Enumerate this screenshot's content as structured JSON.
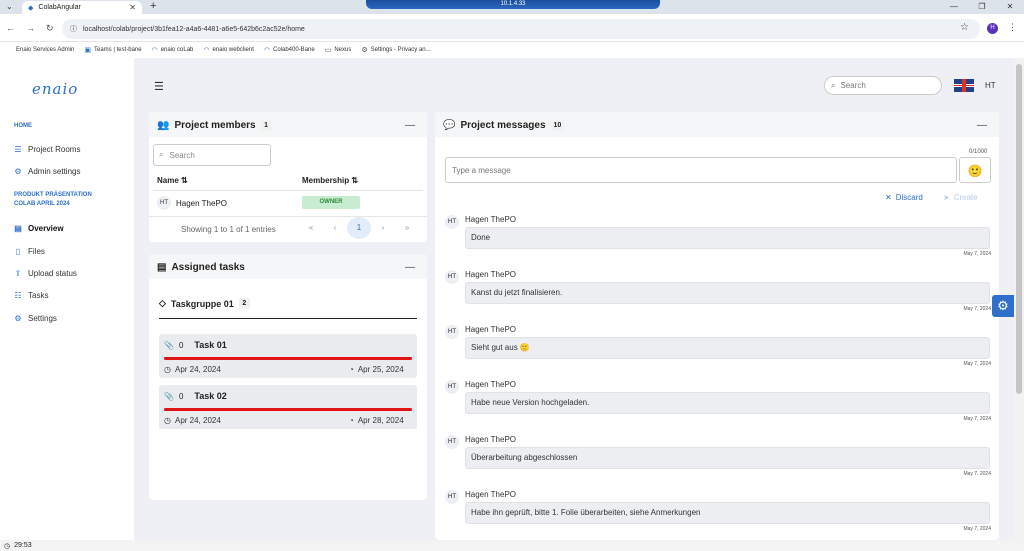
{
  "browser": {
    "tab_title": "ColabAngular",
    "remote_label": "10.1.4.33",
    "url": "localhost/colab/project/3b1fea12-a4a6-4481-a6e5-642b6c2ac52e/home",
    "profile_initial": "H",
    "bookmarks": [
      {
        "label": "Enaio Services Admin"
      },
      {
        "label": "Teams | test-bane"
      },
      {
        "label": "enaio coLab"
      },
      {
        "label": "enaio webclient"
      },
      {
        "label": "Colab400-Bane"
      },
      {
        "label": "Nexus"
      },
      {
        "label": "Settings - Privacy an..."
      }
    ]
  },
  "sidebar": {
    "logo": "enaio",
    "home_header": "HOME",
    "home_items": [
      {
        "label": "Project Rooms",
        "icon": "rooms-icon"
      },
      {
        "label": "Admin settings",
        "icon": "gear-icon"
      }
    ],
    "project_header_line1": "PRODUKT PRÄSENTATION",
    "project_header_line2": "COLAB APRIL 2024",
    "project_items": [
      {
        "label": "Overview",
        "icon": "overview-icon",
        "active": true
      },
      {
        "label": "Files",
        "icon": "file-icon"
      },
      {
        "label": "Upload status",
        "icon": "upload-icon"
      },
      {
        "label": "Tasks",
        "icon": "tasks-icon"
      },
      {
        "label": "Settings",
        "icon": "gear-icon"
      }
    ]
  },
  "header": {
    "search_placeholder": "Search",
    "user_initials": "HT"
  },
  "members": {
    "title": "Project members",
    "count": "1",
    "search_placeholder": "Search",
    "col_name": "Name",
    "col_membership": "Membership",
    "rows": [
      {
        "initials": "HT",
        "name": "Hagen ThePO",
        "membership": "OWNER"
      }
    ],
    "showing": "Showing 1 to 1 of 1 entries",
    "current_page": "1"
  },
  "tasks": {
    "title": "Assigned tasks",
    "group_name": "Taskgruppe 01",
    "group_count": "2",
    "items": [
      {
        "attachments": "0",
        "name": "Task 01",
        "start": "Apr 24, 2024",
        "due": "Apr 25, 2024"
      },
      {
        "attachments": "0",
        "name": "Task 02",
        "start": "Apr 24, 2024",
        "due": "Apr 28, 2024"
      }
    ]
  },
  "messages": {
    "title": "Project messages",
    "count": "10",
    "input_placeholder": "Type a message",
    "counter": "0/1000",
    "discard_label": "Discard",
    "create_label": "Create",
    "items": [
      {
        "initials": "HT",
        "author": "Hagen ThePO",
        "text": "Done",
        "date": "May 7, 2024"
      },
      {
        "initials": "HT",
        "author": "Hagen ThePO",
        "text": "Kanst du jetzt finalisieren.",
        "date": "May 7, 2024"
      },
      {
        "initials": "HT",
        "author": "Hagen ThePO",
        "text": "Sieht gut aus 🙂",
        "date": "May 7, 2024"
      },
      {
        "initials": "HT",
        "author": "Hagen ThePO",
        "text": "Habe neue Version hochgeladen.",
        "date": "May 7, 2024"
      },
      {
        "initials": "HT",
        "author": "Hagen ThePO",
        "text": "Überarbeitung abgeschlossen",
        "date": "May 7, 2024"
      },
      {
        "initials": "HT",
        "author": "Hagen ThePO",
        "text": "Habe ihn geprüft, bitte 1. Folie überarbeiten, siehe Anmerkungen",
        "date": "May 7, 2024"
      }
    ]
  },
  "statusbar": {
    "time": "29:53"
  },
  "colors": {
    "accent": "#2f6fc9",
    "progress": "#e01414",
    "owner_bg": "#c7eccf"
  }
}
